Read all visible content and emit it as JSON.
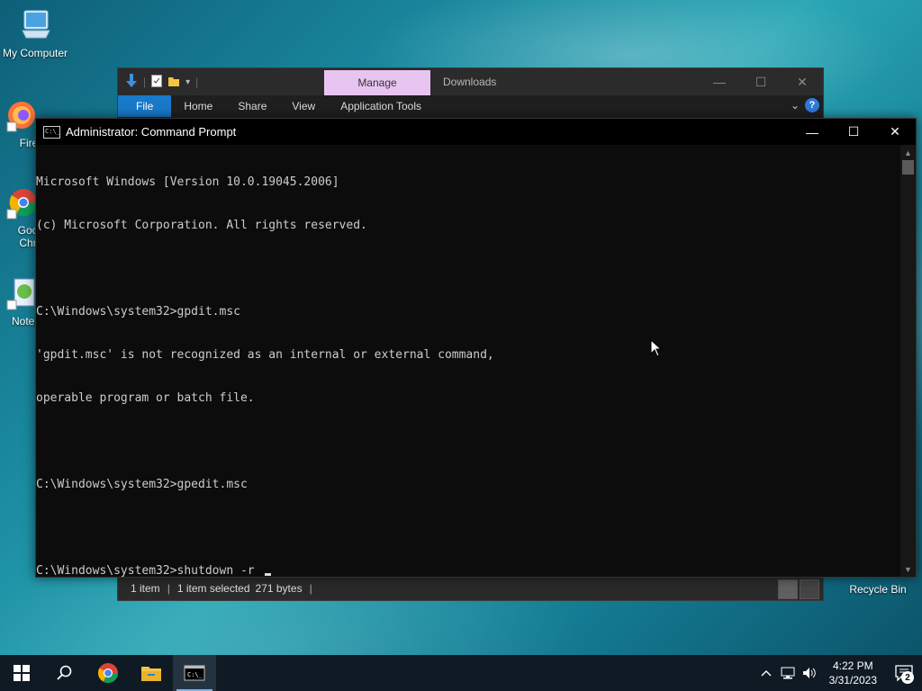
{
  "desktop": {
    "icons": [
      {
        "label": "My Computer"
      },
      {
        "label": "Fire"
      },
      {
        "label": "Goo\nChr"
      },
      {
        "label": "Notep"
      },
      {
        "label": "Recycle Bin"
      }
    ]
  },
  "explorer": {
    "contextual_tab": "Manage",
    "title": "Downloads",
    "ribbon_tabs": [
      "File",
      "Home",
      "Share",
      "View",
      "Application Tools"
    ],
    "status": {
      "items": "1 item",
      "selected": "1 item selected",
      "size": "271 bytes"
    },
    "controls": {
      "minimize": "—",
      "maximize": "☐",
      "close": "✕"
    }
  },
  "cmd": {
    "title": "Administrator: Command Prompt",
    "icon_text": "C:\\_",
    "lines": [
      "Microsoft Windows [Version 10.0.19045.2006]",
      "(c) Microsoft Corporation. All rights reserved.",
      "",
      "C:\\Windows\\system32>gpdit.msc",
      "'gpdit.msc' is not recognized as an internal or external command,",
      "operable program or batch file.",
      "",
      "C:\\Windows\\system32>gpedit.msc",
      "",
      "C:\\Windows\\system32>shutdown -r "
    ],
    "controls": {
      "minimize": "—",
      "maximize": "☐",
      "close": "✕"
    }
  },
  "taskbar": {
    "clock": {
      "time": "4:22 PM",
      "date": "3/31/2023"
    },
    "notification_count": "2"
  },
  "colors": {
    "file_tab": "#1979ca",
    "manage_tab": "#e8c5f1",
    "cmd_bg": "#0c0c0c",
    "cmd_text": "#cccccc",
    "taskbar": "#0f1a24"
  }
}
